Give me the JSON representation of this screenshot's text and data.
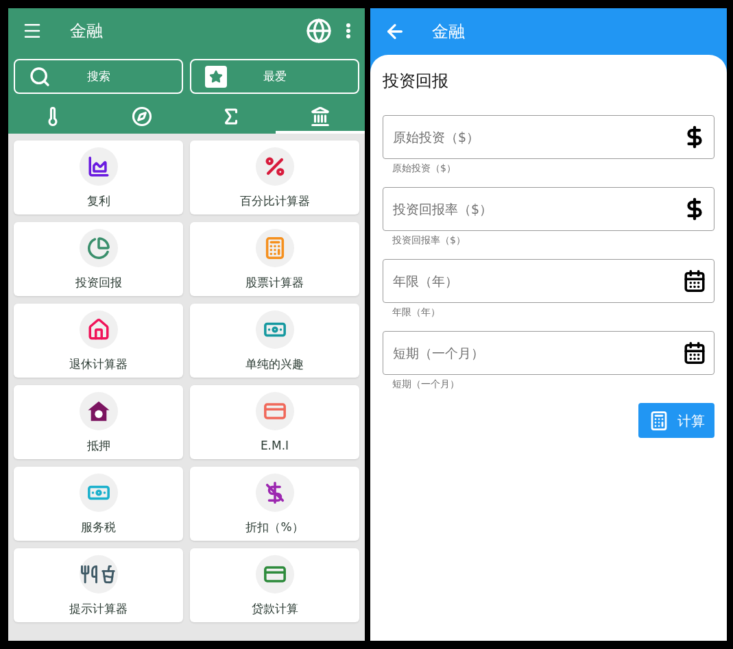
{
  "left": {
    "app_bar": {
      "title": "金融"
    },
    "buttons": [
      {
        "kind": "search",
        "label": "搜索"
      },
      {
        "kind": "star",
        "label": "最爱"
      }
    ],
    "tabs": [
      {
        "kind": "thermometer",
        "selected": false
      },
      {
        "kind": "compass",
        "selected": false
      },
      {
        "kind": "sigma",
        "selected": false
      },
      {
        "kind": "bank",
        "selected": true
      }
    ],
    "items": [
      {
        "kind": "area-chart",
        "color": "#6a1be0",
        "label": "复利"
      },
      {
        "kind": "percent",
        "color": "#d81b3c",
        "label": "百分比计算器"
      },
      {
        "kind": "pie-chart",
        "color": "#3a8f6c",
        "label": "投资回报"
      },
      {
        "kind": "calculator",
        "color": "#f5901e",
        "label": "股票计算器"
      },
      {
        "kind": "house",
        "color": "#f0145a",
        "label": "退休计算器"
      },
      {
        "kind": "banknote",
        "color": "#1699a0",
        "label": "单纯的兴趣"
      },
      {
        "kind": "mortgage",
        "color": "#7b1460",
        "label": "抵押"
      },
      {
        "kind": "card",
        "color": "#f0685a",
        "label": "E.M.I"
      },
      {
        "kind": "cash",
        "color": "#1ab0cc",
        "label": "服务税"
      },
      {
        "kind": "no-dollar",
        "color": "#9c27b0",
        "label": "折扣（%）"
      },
      {
        "kind": "food",
        "color": "#3f5a66",
        "label": "提示计算器"
      },
      {
        "kind": "card",
        "color": "#2e8b3c",
        "label": "贷款计算"
      }
    ]
  },
  "right": {
    "app_bar": {
      "title": "金融"
    },
    "heading": "投资回报",
    "fields": [
      {
        "placeholder": "原始投资（$）",
        "helper": "原始投资（$）",
        "kind": "dollar"
      },
      {
        "placeholder": "投资回报率（$）",
        "helper": "投资回报率（$）",
        "kind": "dollar"
      },
      {
        "placeholder": "年限（年）",
        "helper": "年限（年）",
        "kind": "calendar"
      },
      {
        "placeholder": "短期（一个月）",
        "helper": "短期（一个月）",
        "kind": "calendar"
      }
    ],
    "calculate_button": {
      "label": "计算"
    }
  }
}
